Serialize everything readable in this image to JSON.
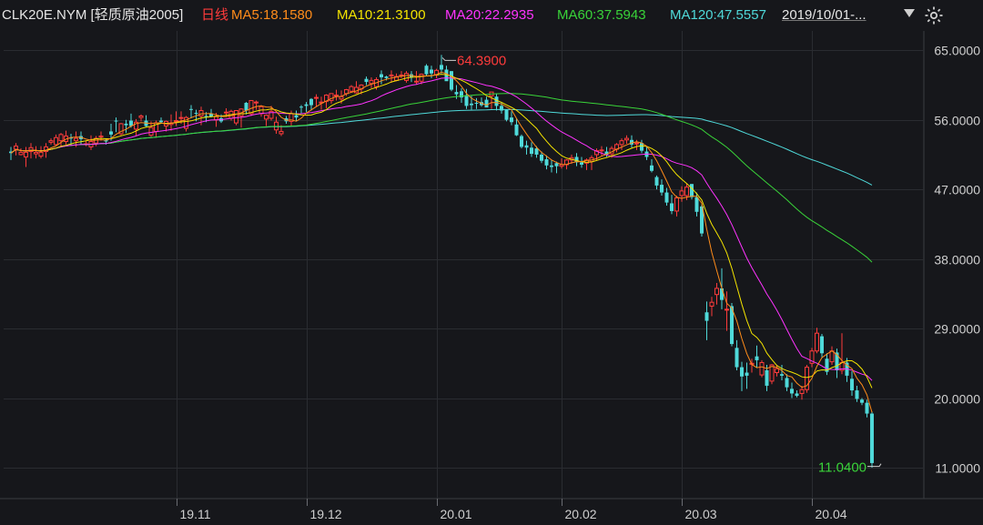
{
  "header": {
    "symbol": "CLK20E.NYM [轻质原油2005]",
    "period": "日线",
    "ma5": "MA5:18.1580",
    "ma10": "MA10:21.3100",
    "ma20": "MA20:22.2935",
    "ma60": "MA60:37.5943",
    "ma120": "MA120:47.5557",
    "range": "2019/10/01-...",
    "dropdown_icon": "triangle-down-icon",
    "settings_icon": "settings-icon"
  },
  "colors": {
    "background": "#16171b",
    "up": "#ff3b3b",
    "down": "#4fd9d9",
    "grid": "#2a2c31",
    "axis_text": "#cfcfcf",
    "ma5": "#ff8c1a",
    "ma10": "#f4e400",
    "ma20": "#ff33ff",
    "ma60": "#39d339",
    "ma120": "#4fd9d9",
    "max_label": "#ff3b3b",
    "min_label": "#39d339"
  },
  "chart_data": {
    "type": "candlestick",
    "ylim": [
      7.0,
      67.5
    ],
    "y_ticks": [
      {
        "value": 65,
        "label": "65.0000"
      },
      {
        "value": 56,
        "label": "56.0000"
      },
      {
        "value": 47,
        "label": "47.0000"
      },
      {
        "value": 38,
        "label": "38.0000"
      },
      {
        "value": 29,
        "label": "29.0000"
      },
      {
        "value": 20,
        "label": "20.0000"
      },
      {
        "value": 11,
        "label": "11.0000"
      }
    ],
    "x_ticks": [
      {
        "index": 33,
        "label": "19.11"
      },
      {
        "index": 59,
        "label": "19.12"
      },
      {
        "index": 85,
        "label": "20.01"
      },
      {
        "index": 110,
        "label": "20.02"
      },
      {
        "index": 134,
        "label": "20.03"
      },
      {
        "index": 160,
        "label": "20.04"
      }
    ],
    "max_marker": {
      "index": 86,
      "value": 64.39,
      "label": "64.3900"
    },
    "min_marker": {
      "index": 174,
      "value": 11.04,
      "label": "11.0400"
    },
    "candles": [
      [
        51.9,
        52.5,
        50.8,
        51.7
      ],
      [
        52.2,
        53.0,
        51.4,
        52.6
      ],
      [
        51.5,
        52.3,
        51.4,
        51.8
      ],
      [
        51.2,
        52.5,
        49.9,
        51.8
      ],
      [
        51.9,
        53.0,
        51.0,
        52.4
      ],
      [
        51.6,
        52.6,
        51.0,
        51.8
      ],
      [
        51.3,
        52.6,
        51.0,
        51.8
      ],
      [
        51.9,
        53.0,
        51.1,
        52.5
      ],
      [
        53.1,
        53.6,
        52.8,
        53.3
      ],
      [
        52.8,
        54.1,
        52.6,
        53.7
      ],
      [
        53.3,
        54.3,
        52.5,
        54.1
      ],
      [
        53.2,
        54.6,
        52.8,
        53.9
      ],
      [
        53.7,
        54.2,
        52.7,
        53.6
      ],
      [
        53.3,
        54.5,
        52.5,
        53.6
      ],
      [
        53.9,
        54.5,
        52.8,
        53.5
      ],
      [
        52.9,
        53.3,
        52.6,
        52.9
      ],
      [
        52.5,
        54.0,
        52.1,
        53.2
      ],
      [
        53.0,
        53.9,
        52.6,
        53.6
      ],
      [
        53.9,
        54.5,
        53.3,
        53.9
      ],
      [
        53.4,
        53.6,
        52.8,
        53.2
      ],
      [
        54.5,
        55.5,
        53.3,
        54.1
      ],
      [
        55.9,
        56.3,
        54.4,
        55.8
      ],
      [
        54.2,
        55.6,
        54.0,
        55.5
      ],
      [
        55.5,
        56.0,
        54.3,
        55.3
      ],
      [
        55.9,
        56.8,
        55.0,
        55.2
      ],
      [
        54.8,
        56.1,
        53.9,
        55.7
      ],
      [
        56.3,
        56.7,
        55.8,
        56.5
      ],
      [
        55.9,
        56.6,
        55.1,
        55.2
      ],
      [
        54.0,
        55.8,
        53.8,
        55.0
      ],
      [
        54.5,
        55.9,
        53.7,
        55.6
      ],
      [
        55.9,
        56.3,
        55.5,
        55.7
      ],
      [
        55.2,
        55.9,
        54.5,
        55.8
      ],
      [
        55.4,
        56.7,
        54.6,
        55.6
      ],
      [
        55.9,
        57.1,
        55.2,
        55.9
      ],
      [
        56.3,
        57.1,
        55.5,
        56.3
      ],
      [
        54.9,
        56.5,
        54.5,
        56.3
      ],
      [
        57.4,
        57.9,
        56.2,
        57.3
      ],
      [
        56.9,
        57.3,
        55.8,
        56.8
      ],
      [
        56.5,
        57.7,
        55.3,
        57.2
      ],
      [
        56.5,
        57.0,
        55.7,
        56.4
      ],
      [
        56.8,
        57.4,
        56.3,
        56.4
      ],
      [
        56.0,
        56.9,
        55.1,
        56.4
      ],
      [
        56.2,
        56.7,
        55.6,
        55.8
      ],
      [
        57.0,
        57.5,
        56.4,
        57.0
      ],
      [
        56.2,
        57.3,
        55.9,
        57.1
      ],
      [
        55.6,
        57.2,
        55.3,
        57.2
      ],
      [
        56.5,
        57.5,
        55.0,
        57.4
      ],
      [
        58.2,
        58.3,
        56.7,
        57.2
      ],
      [
        56.8,
        58.5,
        56.5,
        58.5
      ],
      [
        58.2,
        58.5,
        57.3,
        58.3
      ],
      [
        56.8,
        57.9,
        56.4,
        57.7
      ],
      [
        56.1,
        56.7,
        55.2,
        56.6
      ],
      [
        56.2,
        57.8,
        55.9,
        57.1
      ],
      [
        54.7,
        56.4,
        54.2,
        55.7
      ],
      [
        54.2,
        55.3,
        53.9,
        54.5
      ],
      [
        56.2,
        56.5,
        55.5,
        55.8
      ],
      [
        55.8,
        57.2,
        55.2,
        56.8
      ],
      [
        56.6,
        57.2,
        55.8,
        56.3
      ],
      [
        57.7,
        57.9,
        56.8,
        57.6
      ],
      [
        58.0,
        58.3,
        57.0,
        57.8
      ],
      [
        58.7,
        58.8,
        57.2,
        57.9
      ],
      [
        58.8,
        59.3,
        57.7,
        58.9
      ],
      [
        58.2,
        59.0,
        57.3,
        58.3
      ],
      [
        58.4,
        59.3,
        57.5,
        59.2
      ],
      [
        58.5,
        59.4,
        58.1,
        59.4
      ],
      [
        59.1,
        59.9,
        58.5,
        59.2
      ],
      [
        58.7,
        59.8,
        58.1,
        59.0
      ],
      [
        59.4,
        60.0,
        59.1,
        59.9
      ],
      [
        59.7,
        60.5,
        59.5,
        60.3
      ],
      [
        59.5,
        61.0,
        59.4,
        60.2
      ],
      [
        60.0,
        60.6,
        59.3,
        60.5
      ],
      [
        61.3,
        61.6,
        60.5,
        60.9
      ],
      [
        60.7,
        61.5,
        60.1,
        61.1
      ],
      [
        60.3,
        61.5,
        59.9,
        61.2
      ],
      [
        61.9,
        62.4,
        60.6,
        61.5
      ],
      [
        61.6,
        61.7,
        61.1,
        61.4
      ],
      [
        61.7,
        62.4,
        60.8,
        61.8
      ],
      [
        61.1,
        62.0,
        61.0,
        61.6
      ],
      [
        61.8,
        62.3,
        61.4,
        61.8
      ],
      [
        61.1,
        62.3,
        60.8,
        62.0
      ],
      [
        61.9,
        62.3,
        60.9,
        61.5
      ],
      [
        60.9,
        62.3,
        60.6,
        61.0
      ],
      [
        61.0,
        62.0,
        60.6,
        61.9
      ],
      [
        63.0,
        63.2,
        61.7,
        61.9
      ],
      [
        62.5,
        63.0,
        61.4,
        62.0
      ],
      [
        61.8,
        62.6,
        61.4,
        62.4
      ],
      [
        63.1,
        64.4,
        62.0,
        62.5
      ],
      [
        62.5,
        63.0,
        61.1,
        61.0
      ],
      [
        62.3,
        62.3,
        59.7,
        59.9
      ],
      [
        59.6,
        60.5,
        58.7,
        59.3
      ],
      [
        59.7,
        60.1,
        58.2,
        58.9
      ],
      [
        59.2,
        60.0,
        57.4,
        57.8
      ],
      [
        58.1,
        59.1,
        57.3,
        57.9
      ],
      [
        58.2,
        58.8,
        57.4,
        58.1
      ],
      [
        58.3,
        58.9,
        57.7,
        57.9
      ],
      [
        58.6,
        59.0,
        57.8,
        57.6
      ],
      [
        59.1,
        59.6,
        57.4,
        59.6
      ],
      [
        59.0,
        59.4,
        57.2,
        57.8
      ],
      [
        57.8,
        58.3,
        56.8,
        57.2
      ],
      [
        57.3,
        57.3,
        55.8,
        56.0
      ],
      [
        56.3,
        57.1,
        55.3,
        55.7
      ],
      [
        55.4,
        56.2,
        53.9,
        54.0
      ],
      [
        53.9,
        54.1,
        52.3,
        52.5
      ],
      [
        52.7,
        53.3,
        51.5,
        52.4
      ],
      [
        52.4,
        53.1,
        51.2,
        51.6
      ],
      [
        52.3,
        52.6,
        51.1,
        51.5
      ],
      [
        51.5,
        51.9,
        50.4,
        50.7
      ],
      [
        50.9,
        51.4,
        49.6,
        50.1
      ],
      [
        50.1,
        50.8,
        49.2,
        49.9
      ],
      [
        50.4,
        50.6,
        49.1,
        50.0
      ],
      [
        50.0,
        51.0,
        49.7,
        50.2
      ],
      [
        50.2,
        50.9,
        49.6,
        50.8
      ],
      [
        50.8,
        51.5,
        50.3,
        51.1
      ],
      [
        51.2,
        51.7,
        50.0,
        50.5
      ],
      [
        50.5,
        51.2,
        49.8,
        50.2
      ],
      [
        50.4,
        51.0,
        49.5,
        50.8
      ],
      [
        50.6,
        51.4,
        49.5,
        51.1
      ],
      [
        51.5,
        52.3,
        50.8,
        52.0
      ],
      [
        52.0,
        52.6,
        51.3,
        52.1
      ],
      [
        51.9,
        52.5,
        51.2,
        51.5
      ],
      [
        51.6,
        52.6,
        51.1,
        52.3
      ],
      [
        52.2,
        53.0,
        51.8,
        52.8
      ],
      [
        52.8,
        53.6,
        52.1,
        53.3
      ],
      [
        53.4,
        54.0,
        52.9,
        53.6
      ],
      [
        53.4,
        54.0,
        52.4,
        52.8
      ],
      [
        52.9,
        53.4,
        52.1,
        53.0
      ],
      [
        53.0,
        53.4,
        51.7,
        52.0
      ],
      [
        51.9,
        52.5,
        50.8,
        51.2
      ],
      [
        50.1,
        50.9,
        49.2,
        49.4
      ],
      [
        48.6,
        48.8,
        47.0,
        47.5
      ],
      [
        47.6,
        48.3,
        46.2,
        46.6
      ],
      [
        46.6,
        47.2,
        44.9,
        45.3
      ],
      [
        45.2,
        46.3,
        43.8,
        44.2
      ],
      [
        44.2,
        46.2,
        43.5,
        45.9
      ],
      [
        46.2,
        47.4,
        45.4,
        46.8
      ],
      [
        46.2,
        47.8,
        45.6,
        47.3
      ],
      [
        47.7,
        47.7,
        45.7,
        46.0
      ],
      [
        46.0,
        46.6,
        43.5,
        44.1
      ],
      [
        44.8,
        45.1,
        40.9,
        41.3
      ],
      [
        31.1,
        32.5,
        27.5,
        30.0
      ],
      [
        31.9,
        33.1,
        30.6,
        32.4
      ],
      [
        33.4,
        34.9,
        32.1,
        34.2
      ],
      [
        34.2,
        36.8,
        31.5,
        32.7
      ],
      [
        31.5,
        33.8,
        28.7,
        31.5
      ],
      [
        31.9,
        32.3,
        26.7,
        27.0
      ],
      [
        26.5,
        27.5,
        23.6,
        24.0
      ],
      [
        24.0,
        24.7,
        20.9,
        22.8
      ],
      [
        23.3,
        24.6,
        21.2,
        22.9
      ],
      [
        24.5,
        25.1,
        23.3,
        24.5
      ],
      [
        25.4,
        26.8,
        23.9,
        24.9
      ],
      [
        23.0,
        24.9,
        22.7,
        24.6
      ],
      [
        23.6,
        24.3,
        20.9,
        21.6
      ],
      [
        22.2,
        24.4,
        21.8,
        24.3
      ],
      [
        23.3,
        24.3,
        22.8,
        23.8
      ],
      [
        23.1,
        24.3,
        22.3,
        22.9
      ],
      [
        22.6,
        23.1,
        20.9,
        21.4
      ],
      [
        21.2,
        22.0,
        20.0,
        20.6
      ],
      [
        20.6,
        21.0,
        20.1,
        20.3
      ],
      [
        20.6,
        21.6,
        19.8,
        21.1
      ],
      [
        21.1,
        24.3,
        20.7,
        24.0
      ],
      [
        24.5,
        26.5,
        24.0,
        26.1
      ],
      [
        26.1,
        29.1,
        25.8,
        28.4
      ],
      [
        28.0,
        28.3,
        25.3,
        25.8
      ],
      [
        25.1,
        25.8,
        23.0,
        23.4
      ],
      [
        24.7,
        26.7,
        24.3,
        26.1
      ],
      [
        25.9,
        26.4,
        22.6,
        23.6
      ],
      [
        23.6,
        28.4,
        23.1,
        24.6
      ],
      [
        24.6,
        25.2,
        22.1,
        22.9
      ],
      [
        22.5,
        23.5,
        20.3,
        21.0
      ],
      [
        21.0,
        21.6,
        19.5,
        19.9
      ],
      [
        19.8,
        20.0,
        19.1,
        19.4
      ],
      [
        19.4,
        19.8,
        17.5,
        18.0
      ],
      [
        18.0,
        18.3,
        11.0,
        11.6
      ]
    ],
    "ma_end": [
      {
        "name": "MA5",
        "value": 18.158
      },
      {
        "name": "MA10",
        "value": 21.31
      },
      {
        "name": "MA20",
        "value": 22.2935
      },
      {
        "name": "MA60",
        "value": 37.5943
      },
      {
        "name": "MA120",
        "value": 47.5557
      }
    ]
  }
}
